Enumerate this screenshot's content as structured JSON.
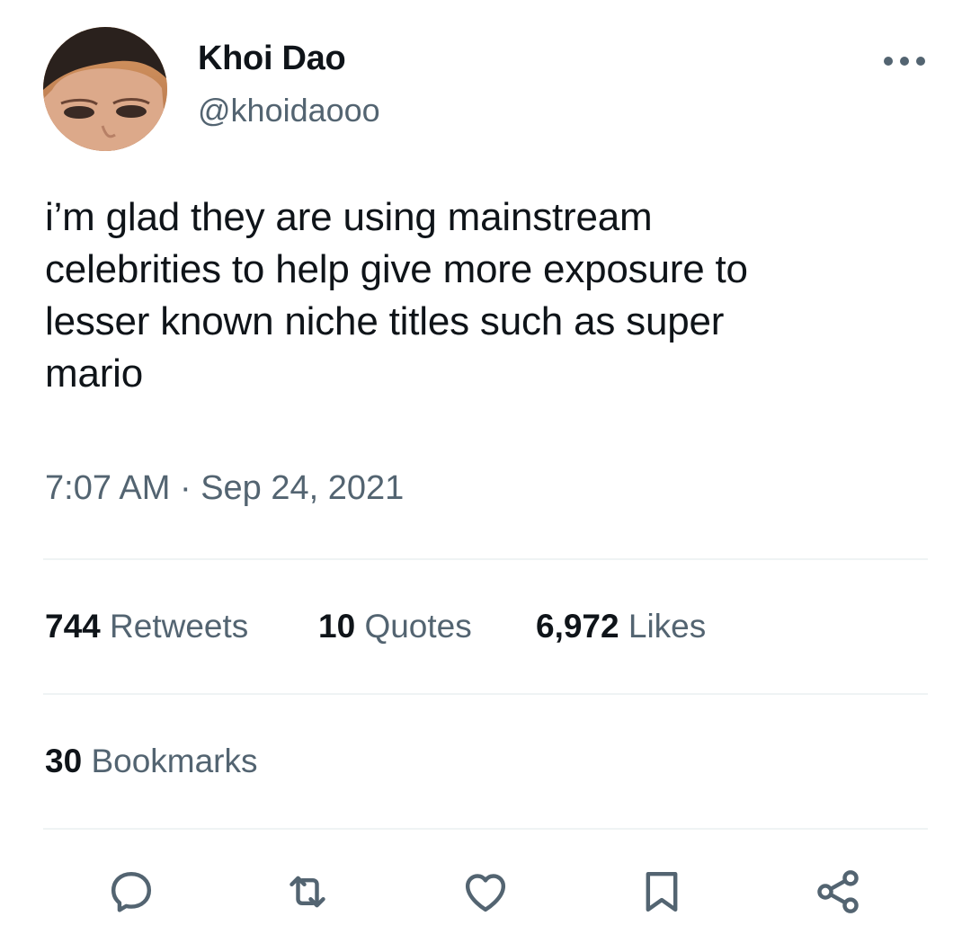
{
  "author": {
    "display_name": "Khoi Dao",
    "handle": "@khoidaooo",
    "avatar_icon": "profile-photo"
  },
  "tweet": {
    "text_lines": [
      "i’m glad they are using mainstream",
      "celebrities to help give more exposure to",
      "lesser known niche titles such as super",
      "mario"
    ],
    "timestamp": "7:07 AM · Sep 24, 2021"
  },
  "stats": {
    "retweets": {
      "count": "744",
      "label": "Retweets"
    },
    "quotes": {
      "count": "10",
      "label": "Quotes"
    },
    "likes": {
      "count": "6,972",
      "label": "Likes"
    },
    "bookmarks": {
      "count": "30",
      "label": "Bookmarks"
    }
  },
  "actions": [
    {
      "icon": "reply-icon"
    },
    {
      "icon": "retweet-icon"
    },
    {
      "icon": "like-icon"
    },
    {
      "icon": "bookmark-icon"
    },
    {
      "icon": "share-icon"
    }
  ],
  "colors": {
    "primary_text": "#0f1419",
    "secondary_text": "#536471",
    "divider": "#eff3f4"
  }
}
